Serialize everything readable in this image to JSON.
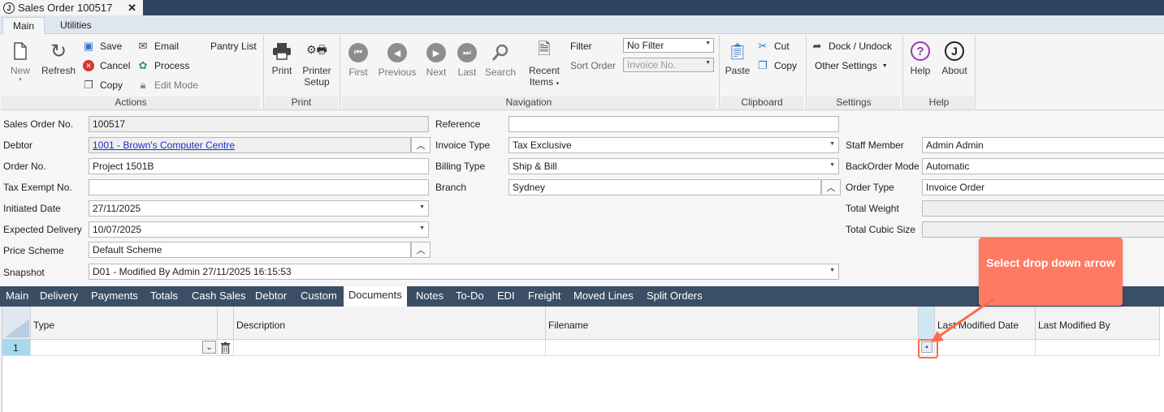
{
  "window": {
    "title": "Sales Order 100517",
    "logo": "J"
  },
  "ribbon_tabs": [
    "Main",
    "Utilities"
  ],
  "ribbon": {
    "actions": {
      "new": "New",
      "refresh": "Refresh",
      "save": "Save",
      "cancel": "Cancel",
      "copy": "Copy",
      "email": "Email",
      "process": "Process",
      "edit_mode": "Edit Mode",
      "pantry_list": "Pantry List",
      "group_label": "Actions"
    },
    "print": {
      "print": "Print",
      "printer_setup_1": "Printer",
      "printer_setup_2": "Setup",
      "group_label": "Print"
    },
    "navigation": {
      "first": "First",
      "previous": "Previous",
      "next": "Next",
      "last": "Last",
      "search": "Search",
      "recent_1": "Recent",
      "recent_2": "Items",
      "filter_label": "Filter",
      "filter_value": "No Filter",
      "sort_label": "Sort Order",
      "sort_value": "Invoice No.",
      "group_label": "Navigation"
    },
    "clipboard": {
      "paste": "Paste",
      "cut": "Cut",
      "copy": "Copy",
      "group_label": "Clipboard"
    },
    "settings": {
      "dock": "Dock / Undock",
      "other": "Other Settings",
      "group_label": "Settings"
    },
    "help": {
      "help": "Help",
      "about": "About",
      "group_label": "Help"
    }
  },
  "form": {
    "sales_order_no": {
      "label": "Sales Order No.",
      "value": "100517"
    },
    "debtor": {
      "label": "Debtor",
      "value": "1001 - Brown's Computer Centre"
    },
    "order_no": {
      "label": "Order No.",
      "value": "Project 1501B"
    },
    "tax_exempt_no": {
      "label": "Tax Exempt No.",
      "value": ""
    },
    "initiated_date": {
      "label": "Initiated Date",
      "value": "27/11/2025"
    },
    "expected_delivery": {
      "label": "Expected Delivery",
      "value": "10/07/2025"
    },
    "price_scheme": {
      "label": "Price Scheme",
      "value": "Default Scheme"
    },
    "snapshot": {
      "label": "Snapshot",
      "value": "D01 - Modified By Admin 27/11/2025 16:15:53"
    },
    "reference": {
      "label": "Reference",
      "value": ""
    },
    "invoice_type": {
      "label": "Invoice Type",
      "value": "Tax Exclusive"
    },
    "billing_type": {
      "label": "Billing Type",
      "value": "Ship & Bill"
    },
    "branch": {
      "label": "Branch",
      "value": "Sydney"
    },
    "staff_member": {
      "label": "Staff Member",
      "value": "Admin Admin"
    },
    "backorder_mode": {
      "label": "BackOrder Mode",
      "value": "Automatic"
    },
    "order_type": {
      "label": "Order Type",
      "value": "Invoice Order"
    },
    "total_weight": {
      "label": "Total Weight",
      "value": ""
    },
    "total_cubic_size": {
      "label": "Total Cubic Size",
      "value": ""
    }
  },
  "bottom_tabs": [
    "Main",
    "Delivery",
    "Payments",
    "Totals",
    "Cash Sales",
    "Debtor",
    "Custom",
    "Documents",
    "Notes",
    "To-Do",
    "EDI",
    "Freight",
    "Moved Lines",
    "Split Orders"
  ],
  "grid": {
    "columns": [
      "Type",
      "Description",
      "Filename",
      "Last Modified Date",
      "Last Modified By"
    ],
    "rows": [
      {
        "row_no": "1",
        "type": "",
        "description": "",
        "filename": "",
        "last_modified_date": "",
        "last_modified_by": ""
      }
    ]
  },
  "callout": {
    "text": "Select drop down arrow"
  },
  "colors": {
    "titlebar": "#2e4361",
    "tabstrip": "#3a4e66",
    "callout": "#ff7a63",
    "link": "#1a2fd1"
  }
}
